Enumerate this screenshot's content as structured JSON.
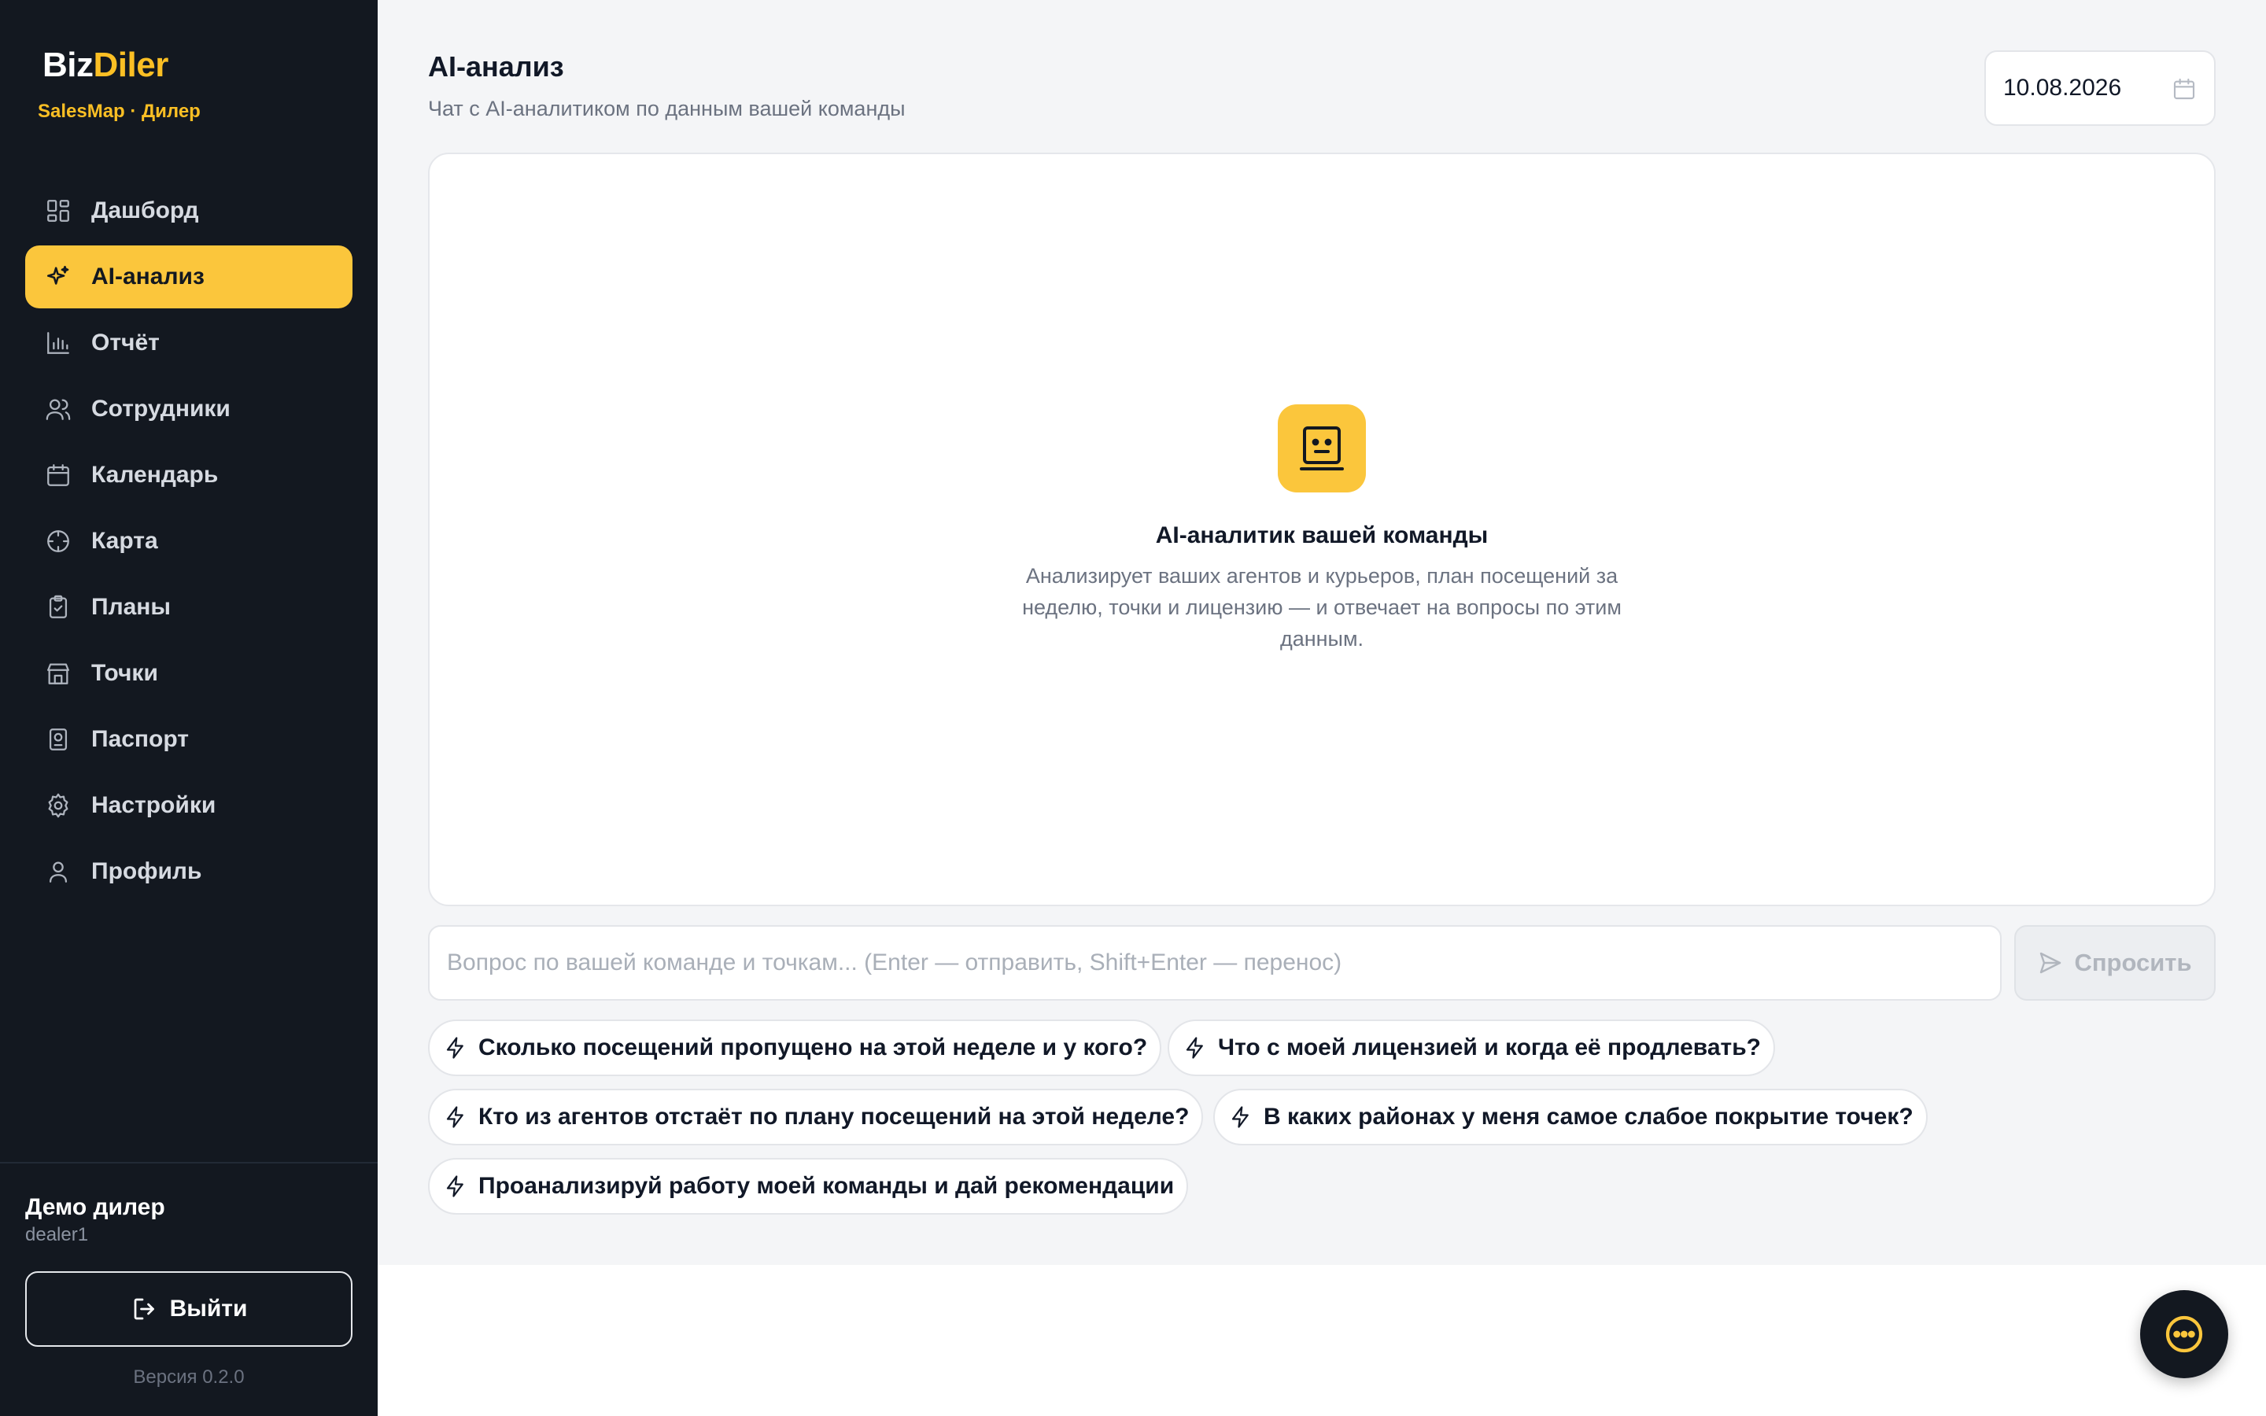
{
  "brand": {
    "name_part1": "Biz",
    "name_part2": "Diler",
    "subtitle": "SalesMap · Дилер"
  },
  "sidebar": {
    "items": [
      {
        "label": "Дашборд",
        "icon": "dashboard-icon"
      },
      {
        "label": "AI-анализ",
        "icon": "sparkle-icon",
        "active": true
      },
      {
        "label": "Отчёт",
        "icon": "bar-chart-icon"
      },
      {
        "label": "Сотрудники",
        "icon": "users-icon"
      },
      {
        "label": "Календарь",
        "icon": "calendar-icon"
      },
      {
        "label": "Карта",
        "icon": "crosshair-icon"
      },
      {
        "label": "Планы",
        "icon": "clipboard-check-icon"
      },
      {
        "label": "Точки",
        "icon": "store-icon"
      },
      {
        "label": "Паспорт",
        "icon": "passport-icon"
      },
      {
        "label": "Настройки",
        "icon": "gear-icon"
      },
      {
        "label": "Профиль",
        "icon": "user-icon"
      }
    ],
    "user": {
      "name": "Демо дилер",
      "login": "dealer1"
    },
    "logout_label": "Выйти",
    "version": "Версия 0.2.0"
  },
  "header": {
    "title": "AI-анализ",
    "subtitle": "Чат с AI-аналитиком по данным вашей команды",
    "date": "10.08.2026"
  },
  "chat": {
    "empty_title": "AI-аналитик вашей команды",
    "empty_desc": "Анализирует ваших агентов и курьеров, план посещений за неделю, точки и лицензию — и отвечает на вопросы по этим данным.",
    "input_placeholder": "Вопрос по вашей команде и точкам... (Enter — отправить, Shift+Enter — перенос)",
    "ask_label": "Спросить"
  },
  "suggestions": [
    "Сколько посещений пропущено на этой неделе и у кого?",
    "Что с моей лицензией и когда её продлевать?",
    "Кто из агентов отстаёт по плану посещений на этой неделе?",
    "В каких районах у меня самое слабое покрытие точек?",
    "Проанализируй работу моей команды и дай рекомендации"
  ],
  "colors": {
    "accent": "#fbc63c",
    "sidebar_bg": "#131820",
    "main_bg": "#f4f5f7"
  }
}
